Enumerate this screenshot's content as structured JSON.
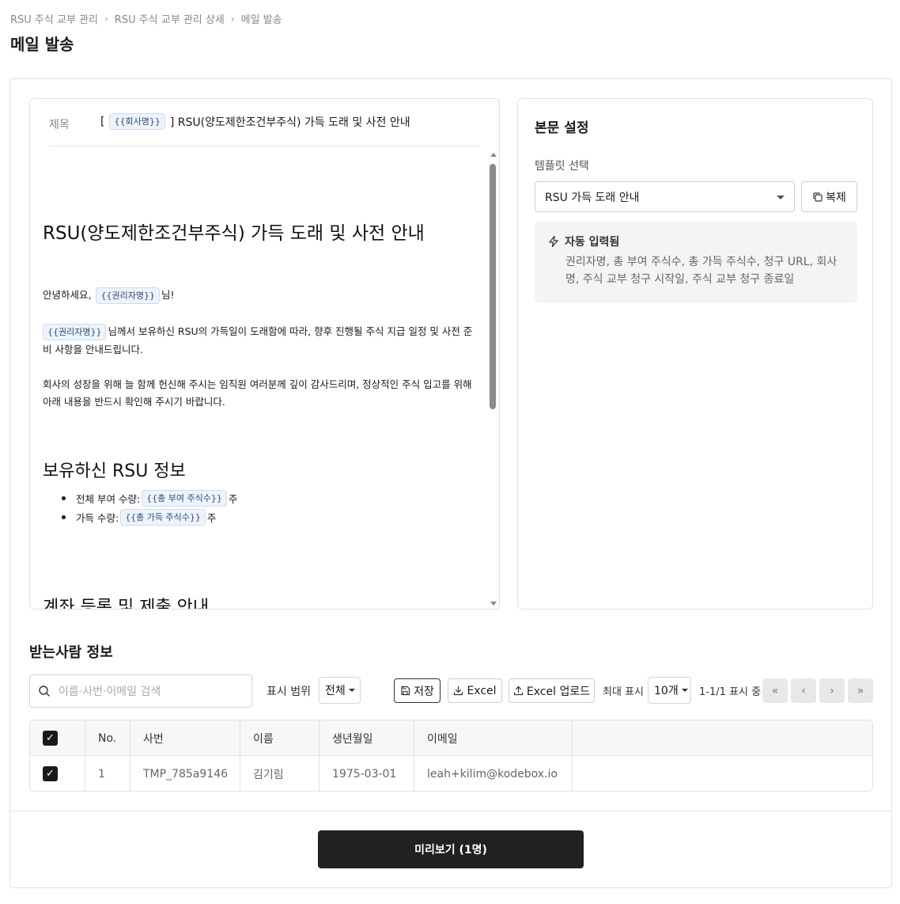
{
  "breadcrumb": [
    "RSU 주식 교부 관리",
    "RSU 주식 교부 관리 상세",
    "메일 발송"
  ],
  "page_title": "메일 발송",
  "editor": {
    "subject_label": "제목",
    "subject_prefix": "[",
    "subject_var": "{{회사명}}",
    "subject_suffix": "] RSU(양도제한조건부주식) 가득 도래 및 사전 안내",
    "doc_title": "RSU(양도제한조건부주식) 가득 도래 및 사전 안내",
    "greeting_pre": "안녕하세요,",
    "greeting_var": "{{권리자명}}",
    "greeting_post": "님!",
    "para1_var": "{{권리자명}}",
    "para1_text": "님께서 보유하신 RSU의 가득일이 도래함에 따라, 향후 진행될 주식 지급 일정 및 사전 준비 사항을 안내드립니다.",
    "para2_text": "회사의 성장을 위해 늘 함께 헌신해 주시는 임직원 여러분께 깊이 감사드리며, 정상적인 주식 입고를 위해 아래 내용을 반드시 확인해 주시기 바랍니다.",
    "section1_title": "보유하신 RSU 정보",
    "items": [
      {
        "label": "전체 부여 수량:",
        "var": "{{총 부여 주식수}}",
        "unit": "주"
      },
      {
        "label": "가득 수량:",
        "var": "{{총 가득 주식수}}",
        "unit": "주"
      }
    ],
    "section2_title": "계좌 등록 및 제출 안내"
  },
  "settings": {
    "title": "본문 설정",
    "template_label": "템플릿 선택",
    "template_value": "RSU 가득 도래 안내",
    "copy_label": "복제",
    "auto_title": "자동 입력됨",
    "auto_fields": "권리자명, 총 부여 주식수, 총 가득 주식수, 청구 URL, 회사명, 주식 교부 청구 시작일, 주식 교부 청구 종료일"
  },
  "recipients": {
    "title": "받는사람 정보",
    "search_placeholder": "이름·사번·이메일 검색",
    "range_label": "표시 범위",
    "range_value": "전체",
    "save_label": "저장",
    "excel_label": "Excel",
    "excel_upload_label": "Excel 업로드",
    "max_label": "최대 표시",
    "max_value": "10개",
    "page_info": "1-1/1 표시 중",
    "columns": [
      "No.",
      "사번",
      "이름",
      "생년월일",
      "이메일"
    ],
    "rows": [
      {
        "no": "1",
        "emp_id": "TMP_785a9146",
        "name": "김기림",
        "birth": "1975-03-01",
        "email": "leah+kilim@kodebox.io"
      }
    ]
  },
  "preview_label": "미리보기 (1명)",
  "colors": {
    "primary_button": "#212121",
    "var_chip_bg": "#eef3fb",
    "auto_box_bg": "#f4f4f5"
  }
}
